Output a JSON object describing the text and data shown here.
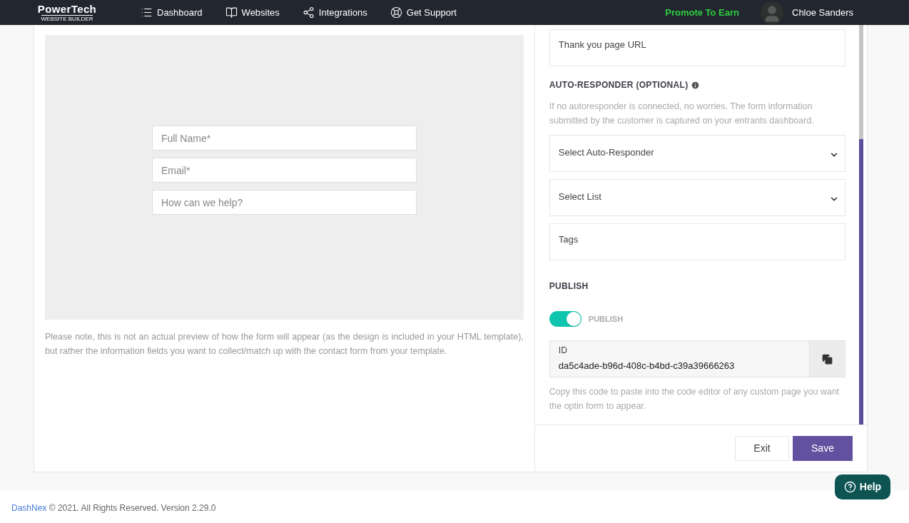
{
  "navbar": {
    "logo": {
      "name": "PowerTech",
      "tagline": "WEBSITE BUILDER"
    },
    "items": [
      {
        "label": "Dashboard"
      },
      {
        "label": "Websites"
      },
      {
        "label": "Integrations"
      },
      {
        "label": "Get Support"
      }
    ],
    "promote": "Promote To Earn",
    "user": "Chloe Sanders"
  },
  "preview": {
    "fields": [
      {
        "placeholder": "Full Name*"
      },
      {
        "placeholder": "Email*"
      },
      {
        "placeholder": "How can we help?"
      }
    ],
    "note": "Please note, this is not an actual preview of how the form will appear (as the design is included in your HTML template), but rather the information fields you want to collect/match up with the contact form from your template."
  },
  "settings": {
    "thank_you": {
      "placeholder": "Thank you page URL"
    },
    "autoresponder": {
      "title": "AUTO-RESPONDER (OPTIONAL)",
      "help": "If no autoresponder is connected, no worries. The form information submitted by the customer is captured on your entrants dashboard.",
      "fields": [
        {
          "kind": "select",
          "placeholder": "Select Auto-Responder"
        },
        {
          "kind": "select",
          "placeholder": "Select List"
        },
        {
          "kind": "text",
          "placeholder": "Tags"
        }
      ]
    },
    "publish": {
      "title": "PUBLISH",
      "toggle_label": "PUBLISH",
      "on": true,
      "id_label": "ID",
      "id_value": "da5c4ade-b96d-408c-b4bd-c39a39666263",
      "help": "Copy this code to paste into the code editor of any custom page you want the optin form to appear."
    }
  },
  "actions": {
    "exit": "Exit",
    "save": "Save"
  },
  "help_button": "Help",
  "footer": {
    "brand": "DashNex",
    "text": "© 2021. All Rights Reserved. Version 2.29.0"
  }
}
